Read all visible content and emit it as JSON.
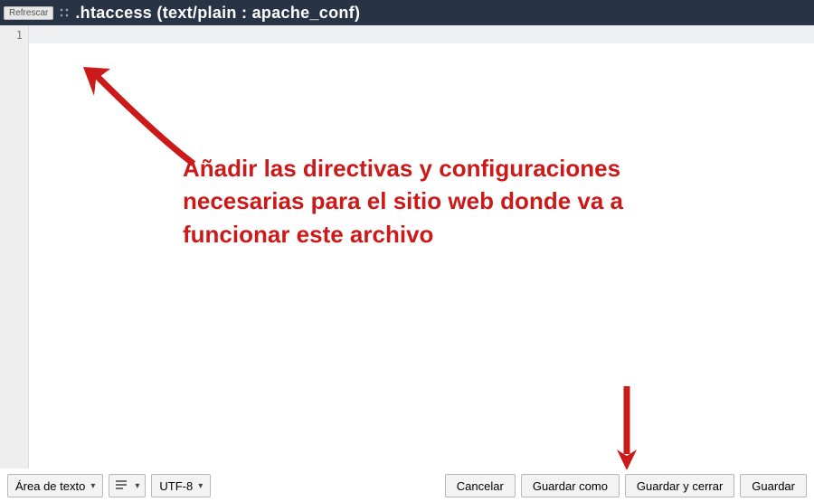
{
  "header": {
    "refresh_label": "Refrescar",
    "title": ".htaccess (text/plain : apache_conf)"
  },
  "editor": {
    "line_number": "1"
  },
  "annotation": {
    "text": "Añadir las directivas y configuraciones necesarias para el sitio web donde va a funcionar este archivo"
  },
  "footer": {
    "mode_label": "Área de texto",
    "encoding_label": "UTF-8",
    "cancel_label": "Cancelar",
    "save_as_label": "Guardar como",
    "save_close_label": "Guardar y cerrar",
    "save_label": "Guardar"
  },
  "colors": {
    "header_bg": "#283446",
    "annotation_red": "#cc1a1a"
  }
}
